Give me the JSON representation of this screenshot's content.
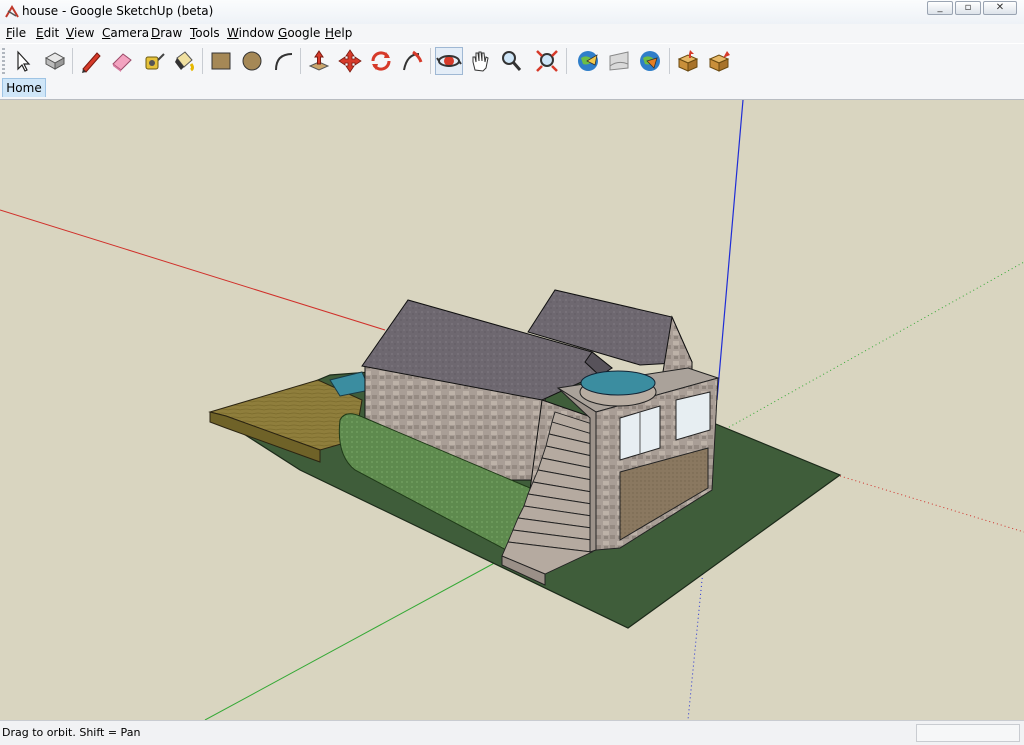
{
  "window": {
    "title": "house - Google SketchUp (beta)",
    "controls": {
      "minimize": "▭",
      "maximize": "▭",
      "close": "✕"
    }
  },
  "menu": {
    "items": [
      {
        "label": "File",
        "underline": "F",
        "rest": "ile"
      },
      {
        "label": "Edit",
        "underline": "E",
        "rest": "dit"
      },
      {
        "label": "View",
        "underline": "V",
        "rest": "iew"
      },
      {
        "label": "Camera",
        "underline": "C",
        "rest": "amera"
      },
      {
        "label": "Draw",
        "underline": "D",
        "rest": "raw"
      },
      {
        "label": "Tools",
        "underline": "T",
        "rest": "ools"
      },
      {
        "label": "Window",
        "underline": "W",
        "rest": "indow"
      },
      {
        "label": "Google",
        "underline": "G",
        "rest": "oogle"
      },
      {
        "label": "Help",
        "underline": "H",
        "rest": "elp"
      }
    ]
  },
  "toolbar": {
    "tools": [
      "select-icon",
      "component-icon",
      "pencil-icon",
      "eraser-icon",
      "tape-measure-icon",
      "paint-bucket-icon",
      "rectangle-icon",
      "circle-icon",
      "arc-icon",
      "push-pull-icon",
      "move-icon",
      "rotate-icon",
      "follow-me-icon",
      "orbit-icon",
      "pan-icon",
      "zoom-icon",
      "zoom-extents-icon",
      "get-current-view-icon",
      "toggle-terrain-icon",
      "place-model-icon",
      "get-models-icon",
      "share-model-icon"
    ]
  },
  "scenes": {
    "active_tab": "Home"
  },
  "status": {
    "message": "Drag to orbit.  Shift = Pan",
    "vcb_value": ""
  },
  "colors": {
    "viewport_background": "#d9d5c0",
    "axis_red": "#d0302a",
    "axis_green": "#35a935",
    "axis_blue": "#1f2dd6",
    "ground": "#3f5d3a",
    "roof": "#6e6870",
    "stone": "#a89d95",
    "deck": "#8a7a3a",
    "pool": "#3b8da0"
  }
}
